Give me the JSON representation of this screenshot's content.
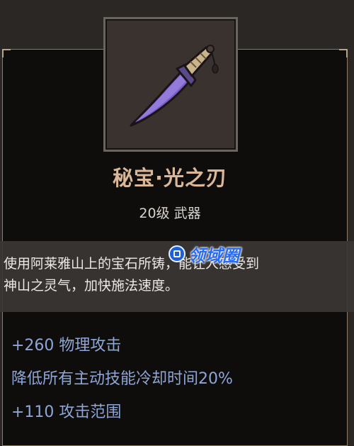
{
  "item": {
    "name": "秘宝·光之刃",
    "level_type": "20级 武器",
    "icon": "purple-blade-icon",
    "description_line1": "使用阿莱雅山上的宝石所铸，能让人感受到",
    "description_line2": "神山之灵气，加快施法速度。"
  },
  "stats": [
    "+260 物理攻击",
    "降低所有主动技能冷却时间20%",
    "+110 攻击范围"
  ],
  "watermark": {
    "text": "领域圈",
    "icon": "watermark-logo-icon"
  },
  "colors": {
    "name": "#d9b89a",
    "stat": "#8ea6d6",
    "border": "#8d7d67",
    "blade": "#7a5dc7"
  }
}
